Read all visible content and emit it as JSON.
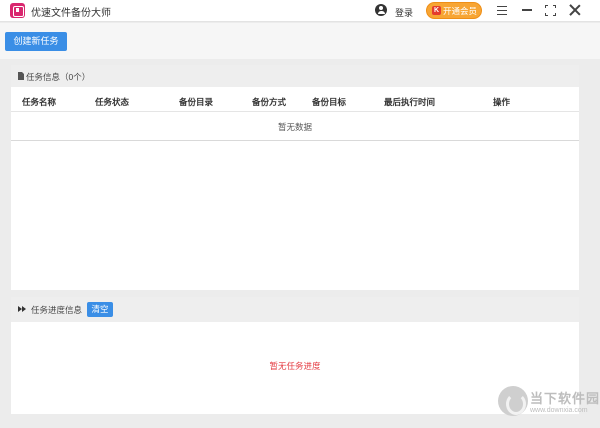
{
  "titlebar": {
    "title": "优速文件备份大师",
    "login_label": "登录",
    "vip_label": "开通会员",
    "vip_icon_glyph": "K",
    "icons": [
      "app-logo",
      "user-icon",
      "menu-icon",
      "minimize-icon",
      "maximize-icon",
      "close-icon"
    ]
  },
  "toolbar": {
    "create_label": "创建新任务"
  },
  "tasks_panel": {
    "title": "任务信息（0个）",
    "columns": [
      "任务名称",
      "任务状态",
      "备份目录",
      "备份方式",
      "备份目标",
      "最后执行时间",
      "操作"
    ],
    "rows": [],
    "empty_text": "暂无数据"
  },
  "progress_panel": {
    "title": "任务进度信息",
    "clear_label": "清空",
    "empty_text": "暂无任务进度"
  },
  "watermark": {
    "name": "当下软件园",
    "url": "www.downxia.com"
  },
  "colors": {
    "primary": "#3a8ee6",
    "vip": "#f7a534",
    "empty_progress": "#e4383f",
    "app_logo": "#d9266e"
  }
}
